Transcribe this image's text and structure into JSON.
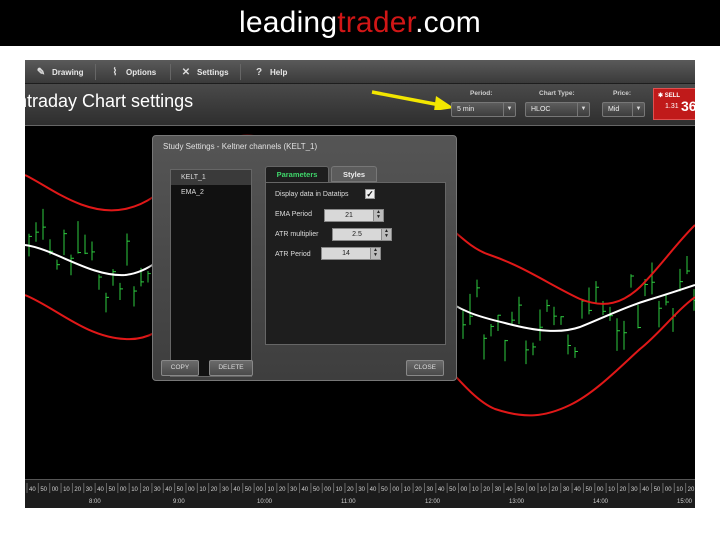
{
  "banner": {
    "brand_prefix": "leading",
    "brand_highlight": "trader",
    "brand_suffix": ".com"
  },
  "menubar": {
    "items": [
      {
        "label": "Drawing",
        "icon": "pencil-icon"
      },
      {
        "label": "Options",
        "icon": "options-icon"
      },
      {
        "label": "Settings",
        "icon": "tools-icon"
      },
      {
        "label": "Help",
        "icon": "help-icon"
      }
    ]
  },
  "toolbar": {
    "period": {
      "label": "Period:",
      "value": "5 min"
    },
    "chart_type": {
      "label": "Chart Type:",
      "value": "HLOC"
    },
    "price": {
      "label": "Price:",
      "value": "Mid"
    },
    "sell": {
      "label": "SELL",
      "price_small": "1.31",
      "price_big": "36"
    }
  },
  "caption": "Intraday Chart settings",
  "dialog": {
    "title": "Study Settings - Keltner channels (KELT_1)",
    "studies": [
      "KELT_1",
      "EMA_2"
    ],
    "tabs": {
      "parameters": "Parameters",
      "styles": "Styles"
    },
    "params": {
      "display_label": "Display data in Datatips",
      "display_checked": "✓",
      "ema_label": "EMA Period",
      "ema_value": "21",
      "atr_mult_label": "ATR multiplier",
      "atr_mult_value": "2.5",
      "atr_period_label": "ATR Period",
      "atr_period_value": "14"
    },
    "buttons": {
      "copy": "COPY",
      "delete": "DELETE",
      "close": "CLOSE"
    }
  },
  "timeaxis": {
    "minute_ticks": [
      "40",
      "50",
      "00",
      "10",
      "20",
      "30",
      "40",
      "50",
      "00",
      "10",
      "20",
      "30",
      "40",
      "50",
      "00",
      "10",
      "20",
      "30",
      "40",
      "50",
      "00",
      "10",
      "20",
      "30",
      "40",
      "50",
      "00",
      "10",
      "20",
      "30",
      "40",
      "50",
      "00",
      "10",
      "20",
      "30",
      "40",
      "50",
      "00",
      "10",
      "20",
      "30",
      "40",
      "50",
      "00",
      "10",
      "20",
      "30",
      "40",
      "50",
      "00",
      "10",
      "20",
      "30",
      "40",
      "50",
      "00",
      "10",
      "20"
    ],
    "hour_labels": [
      "8:00",
      "9:00",
      "10:00",
      "11:00",
      "12:00",
      "13:00",
      "14:00",
      "15:00"
    ]
  },
  "colors": {
    "bands": "#e01818",
    "ema": "#ffffff",
    "bars": "#2ecc40",
    "accent": "#c01a1a"
  }
}
